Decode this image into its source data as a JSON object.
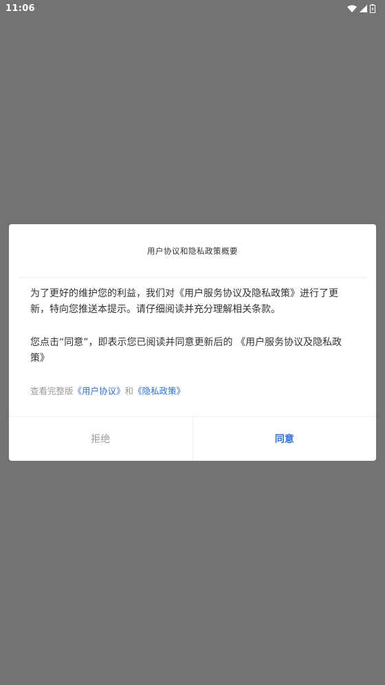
{
  "status_bar": {
    "time": "11:06",
    "icons": [
      "wifi-icon",
      "signal-icon",
      "battery-icon"
    ]
  },
  "dialog": {
    "title": "用户协议和隐私政策概要",
    "paragraph1": "为了更好的维护您的利益，我们对《用户服务协议及隐私政策》进行了更新，特向您推送本提示。请仔细阅读并充分理解相关条款。",
    "paragraph2": "您点击“同意”，即表示您已阅读并同意更新后的 《用户服务协议及隐私政策》",
    "links_prefix": "查看完整版",
    "user_agreement_link": "《用户协议》",
    "links_joiner": "和",
    "privacy_policy_link": "《隐私政策》",
    "reject_label": "拒绝",
    "agree_label": "同意"
  },
  "colors": {
    "overlay": "#737373",
    "accent": "#2f6fd6",
    "muted": "#999999",
    "text": "#333333"
  }
}
